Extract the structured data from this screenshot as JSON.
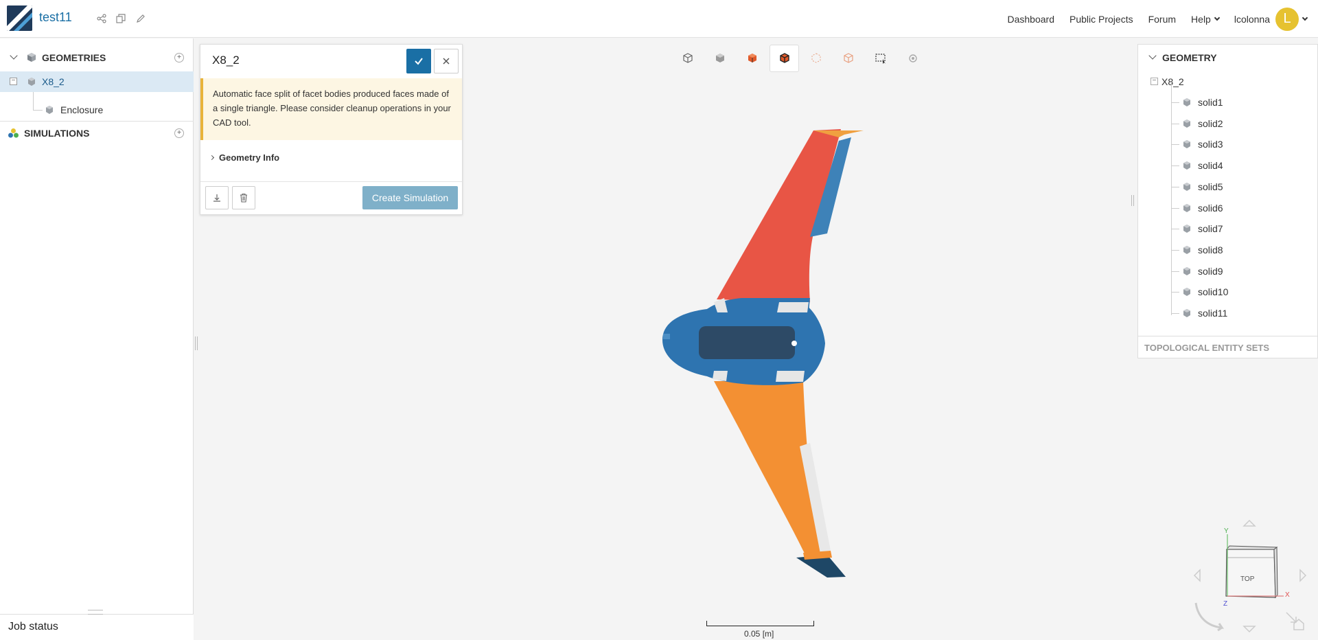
{
  "header": {
    "project_name": "test11",
    "nav": {
      "dashboard": "Dashboard",
      "public_projects": "Public Projects",
      "forum": "Forum",
      "help": "Help"
    },
    "username": "lcolonna",
    "avatar_letter": "L"
  },
  "left_panel": {
    "geometries_label": "GEOMETRIES",
    "geometries": [
      {
        "label": "X8_2",
        "selected": true
      },
      {
        "label": "Enclosure",
        "selected": false
      }
    ],
    "simulations_label": "SIMULATIONS",
    "job_status_label": "Job status"
  },
  "dialog": {
    "title": "X8_2",
    "warning": "Automatic face split of facet bodies produced faces made of a single triangle. Please consider cleanup operations in your CAD tool.",
    "geometry_info_label": "Geometry Info",
    "create_simulation_label": "Create Simulation"
  },
  "viewport": {
    "scale_label": "0.05 [m]",
    "navcube_face": "TOP",
    "axis_y": "Y",
    "axis_x": "X",
    "axis_z": "Z"
  },
  "right_panel": {
    "header": "GEOMETRY",
    "root": "X8_2",
    "solids": [
      "solid1",
      "solid2",
      "solid3",
      "solid4",
      "solid5",
      "solid6",
      "solid7",
      "solid8",
      "solid9",
      "solid10",
      "solid11"
    ],
    "footer": "TOPOLOGICAL ENTITY SETS"
  },
  "colors": {
    "accent": "#1a6fa5",
    "wing_top": "#e85545",
    "wing_bottom": "#f39033",
    "fuselage": "#2e74b0",
    "warning_border": "#e8b33a"
  }
}
